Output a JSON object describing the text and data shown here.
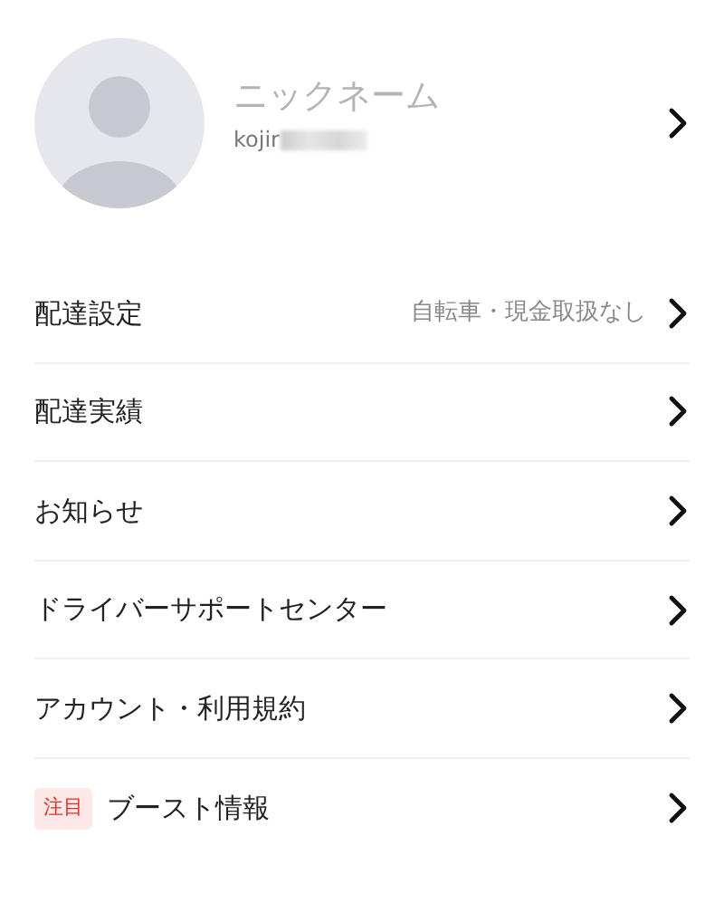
{
  "profile": {
    "nickname": "ニックネーム",
    "username": "kojir"
  },
  "menu": [
    {
      "label": "配達設定",
      "value": "自転車・現金取扱なし"
    },
    {
      "label": "配達実績"
    },
    {
      "label": "お知らせ"
    },
    {
      "label": "ドライバーサポートセンター"
    },
    {
      "label": "アカウント・利用規約"
    },
    {
      "label": "ブースト情報",
      "tag": "注目"
    }
  ]
}
